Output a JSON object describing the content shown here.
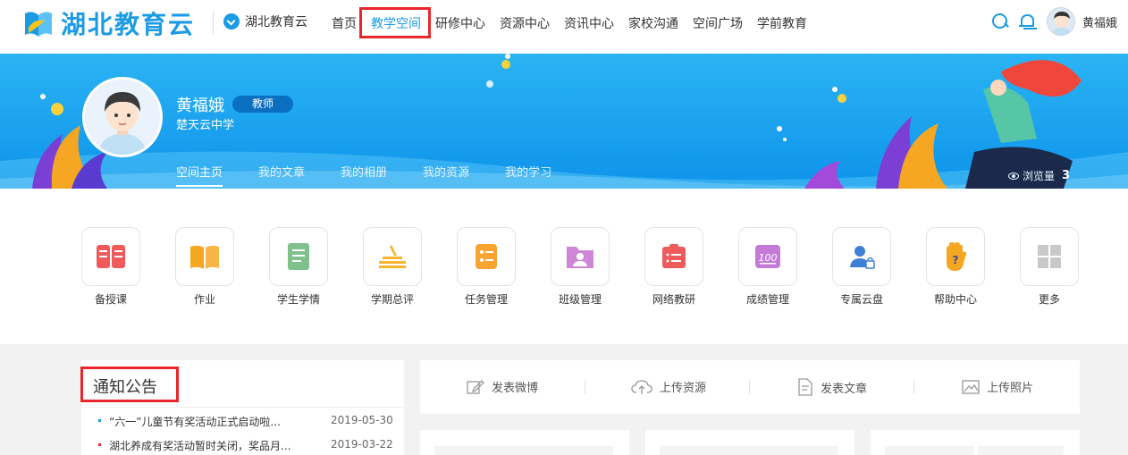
{
  "header": {
    "logo_text": "湖北教育云",
    "region_label": "湖北教育云",
    "nav": [
      "首页",
      "教学空间",
      "研修中心",
      "资源中心",
      "资讯中心",
      "家校沟通",
      "空间广场",
      "学前教育"
    ],
    "active_nav": "教学空间",
    "user_name": "黄福娥"
  },
  "profile": {
    "name": "黄福娥",
    "role": "教师",
    "school": "楚天云中学",
    "tabs": [
      "空间主页",
      "我的文章",
      "我的相册",
      "我的资源",
      "我的学习"
    ],
    "active_tab": "空间主页",
    "views_label": "浏览量",
    "views_count": "3"
  },
  "apps": [
    {
      "label": "备授课",
      "icon": "lesson-icon",
      "color": "#ef5b5b"
    },
    {
      "label": "作业",
      "icon": "homework-book-icon",
      "color": "#f5a623"
    },
    {
      "label": "学生学情",
      "icon": "student-report-icon",
      "color": "#7fc08c"
    },
    {
      "label": "学期总评",
      "icon": "semester-eval-icon",
      "color": "#f5b52e"
    },
    {
      "label": "任务管理",
      "icon": "task-list-icon",
      "color": "#f7a530"
    },
    {
      "label": "班级管理",
      "icon": "class-folder-icon",
      "color": "#cf86d9"
    },
    {
      "label": "网络教研",
      "icon": "clipboard-icon",
      "color": "#ef5b5b"
    },
    {
      "label": "成绩管理",
      "icon": "score-100-icon",
      "color": "#c47bd8"
    },
    {
      "label": "专属云盘",
      "icon": "cloud-user-icon",
      "color": "#3f7fd6"
    },
    {
      "label": "帮助中心",
      "icon": "help-hand-icon",
      "color": "#f5a623"
    },
    {
      "label": "更多",
      "icon": "grid-more-icon",
      "color": "#c9c9c9"
    }
  ],
  "notices": {
    "title": "通知公告",
    "items": [
      {
        "text": "“六一”儿童节有奖活动正式启动啦...",
        "date": "2019-05-30",
        "bullet_color": "#1c9be5"
      },
      {
        "text": "湖北养成有奖活动暂时关闭，奖品月...",
        "date": "2019-03-22",
        "bullet_color": "#e8262c"
      }
    ]
  },
  "post_actions": [
    "发表微博",
    "上传资源",
    "发表文章",
    "上传照片"
  ],
  "colors": {
    "brand": "#1c9be5",
    "highlight": "#e8262c"
  }
}
